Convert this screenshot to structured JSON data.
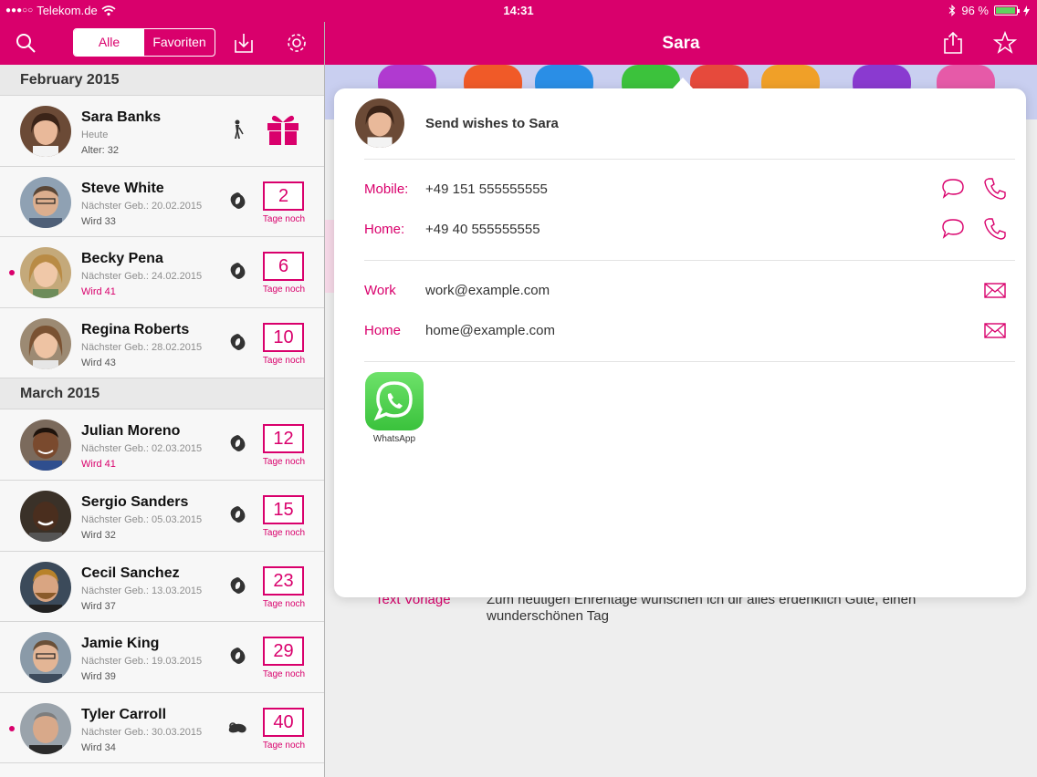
{
  "status_bar": {
    "carrier": "Telekom.de",
    "time": "14:31",
    "battery": "96 %"
  },
  "left_nav": {
    "segments": [
      "Alle",
      "Favoriten"
    ],
    "active_segment": "Alle",
    "icons": [
      "search-icon",
      "download-icon",
      "gear-icon"
    ]
  },
  "right_nav": {
    "title": "Sara",
    "icons": [
      "share-icon",
      "star-icon"
    ]
  },
  "colors": {
    "accent": "#d9006c"
  },
  "sections": [
    {
      "header": "February 2015",
      "rows": [
        {
          "name": "Sara Banks",
          "sub": "Heute",
          "sub2": "Alter: 32",
          "zodiac": "aquarius-icon",
          "gift": true
        },
        {
          "name": "Steve White",
          "sub": "Nächster Geb.: 20.02.2015",
          "sub2": "Wird 33",
          "zodiac": "pisces-icon",
          "count": "2",
          "count_label": "Tage noch"
        },
        {
          "name": "Becky Pena",
          "sub": "Nächster Geb.: 24.02.2015",
          "sub2": "Wird 41",
          "zodiac": "pisces-icon",
          "count": "6",
          "count_label": "Tage noch",
          "highlight": true
        },
        {
          "name": "Regina Roberts",
          "sub": "Nächster Geb.: 28.02.2015",
          "sub2": "Wird 43",
          "zodiac": "pisces-icon",
          "count": "10",
          "count_label": "Tage noch"
        }
      ]
    },
    {
      "header": "March 2015",
      "rows": [
        {
          "name": "Julian Moreno",
          "sub": "Nächster Geb.: 02.03.2015",
          "sub2": "Wird 41",
          "zodiac": "pisces-icon",
          "count": "12",
          "count_label": "Tage noch"
        },
        {
          "name": "Sergio Sanders",
          "sub": "Nächster Geb.: 05.03.2015",
          "sub2": "Wird 32",
          "zodiac": "pisces-icon",
          "count": "15",
          "count_label": "Tage noch"
        },
        {
          "name": "Cecil Sanchez",
          "sub": "Nächster Geb.: 13.03.2015",
          "sub2": "Wird 37",
          "zodiac": "pisces-icon",
          "count": "23",
          "count_label": "Tage noch"
        },
        {
          "name": "Jamie King",
          "sub": "Nächster Geb.: 19.03.2015",
          "sub2": "Wird 39",
          "zodiac": "pisces-icon",
          "count": "29",
          "count_label": "Tage noch"
        },
        {
          "name": "Tyler Carroll",
          "sub": "Nächster Geb.: 30.03.2015",
          "sub2": "Wird 34",
          "zodiac": "aries-icon",
          "count": "40",
          "count_label": "Tage noch",
          "highlight": true
        }
      ]
    }
  ],
  "popover": {
    "title": "Send wishes to Sara",
    "phones": [
      {
        "label": "Mobile:",
        "value": "+49 151 555555555"
      },
      {
        "label": "Home:",
        "value": "+49 40 555555555"
      }
    ],
    "emails": [
      {
        "label": "Work",
        "value": "work@example.com"
      },
      {
        "label": "Home",
        "value": "home@example.com"
      }
    ],
    "apps": [
      {
        "label": "WhatsApp"
      }
    ]
  },
  "detail": {
    "template_label": "Text Vorlage",
    "template_text": "Zum heutigen Ehrentage wünschen ich dir alles erdenklich Gute, einen wunderschönen Tag"
  }
}
